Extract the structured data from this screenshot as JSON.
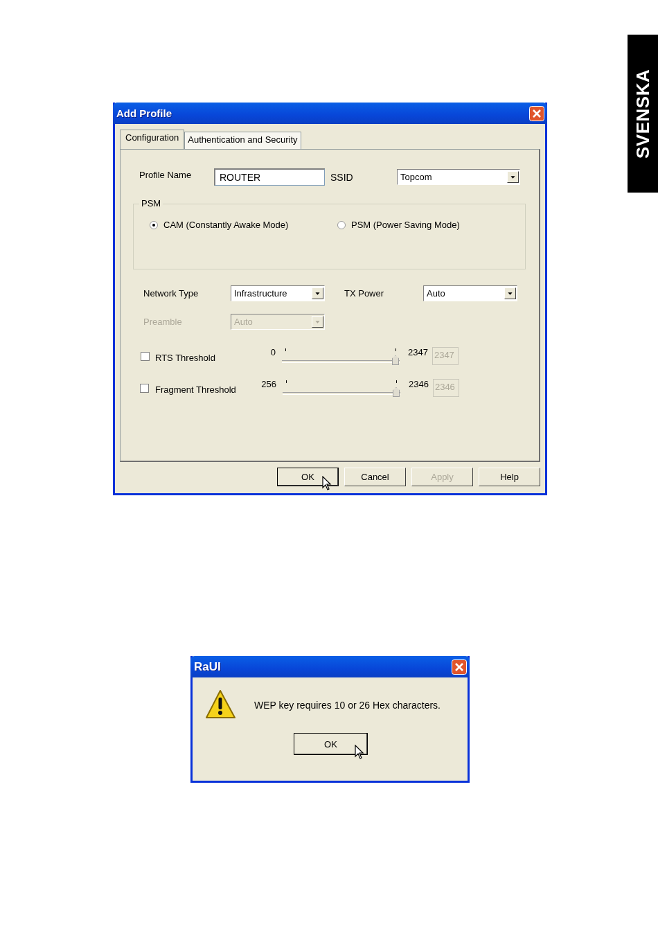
{
  "side_tab": {
    "label": "SVENSKA"
  },
  "add_profile": {
    "title": "Add Profile",
    "tabs": [
      {
        "label": "Configuration",
        "selected": true
      },
      {
        "label": "Authentication and Security",
        "selected": false
      }
    ],
    "profile_name": {
      "label": "Profile Name",
      "value": "ROUTER"
    },
    "ssid": {
      "label": "SSID",
      "value": "Topcom"
    },
    "psm": {
      "title": "PSM",
      "options": [
        {
          "label": "CAM (Constantly Awake Mode)",
          "selected": true
        },
        {
          "label": "PSM (Power Saving Mode)",
          "selected": false
        }
      ]
    },
    "network_type": {
      "label": "Network Type",
      "value": "Infrastructure",
      "disabled": false
    },
    "tx_power": {
      "label": "TX Power",
      "value": "Auto",
      "disabled": false
    },
    "preamble": {
      "label": "Preamble",
      "value": "Auto",
      "disabled": true
    },
    "thresholds": [
      {
        "label": "RTS Threshold",
        "checked": false,
        "min": "0",
        "max": "2347",
        "level": 1,
        "value": "2347",
        "value_disabled": true
      },
      {
        "label": "Fragment Threshold",
        "checked": false,
        "min": "256",
        "max": "2346",
        "level": 1,
        "value": "2346",
        "value_disabled": true
      }
    ],
    "buttons": [
      {
        "label": "OK",
        "disabled": false,
        "focused": true
      },
      {
        "label": "Cancel",
        "disabled": false,
        "focused": false
      },
      {
        "label": "Apply",
        "disabled": true,
        "focused": false
      },
      {
        "label": "Help",
        "disabled": false,
        "focused": false
      }
    ]
  },
  "alert": {
    "title": "RaUI",
    "message": "WEP key requires 10 or 26 Hex characters.",
    "button": "OK"
  }
}
